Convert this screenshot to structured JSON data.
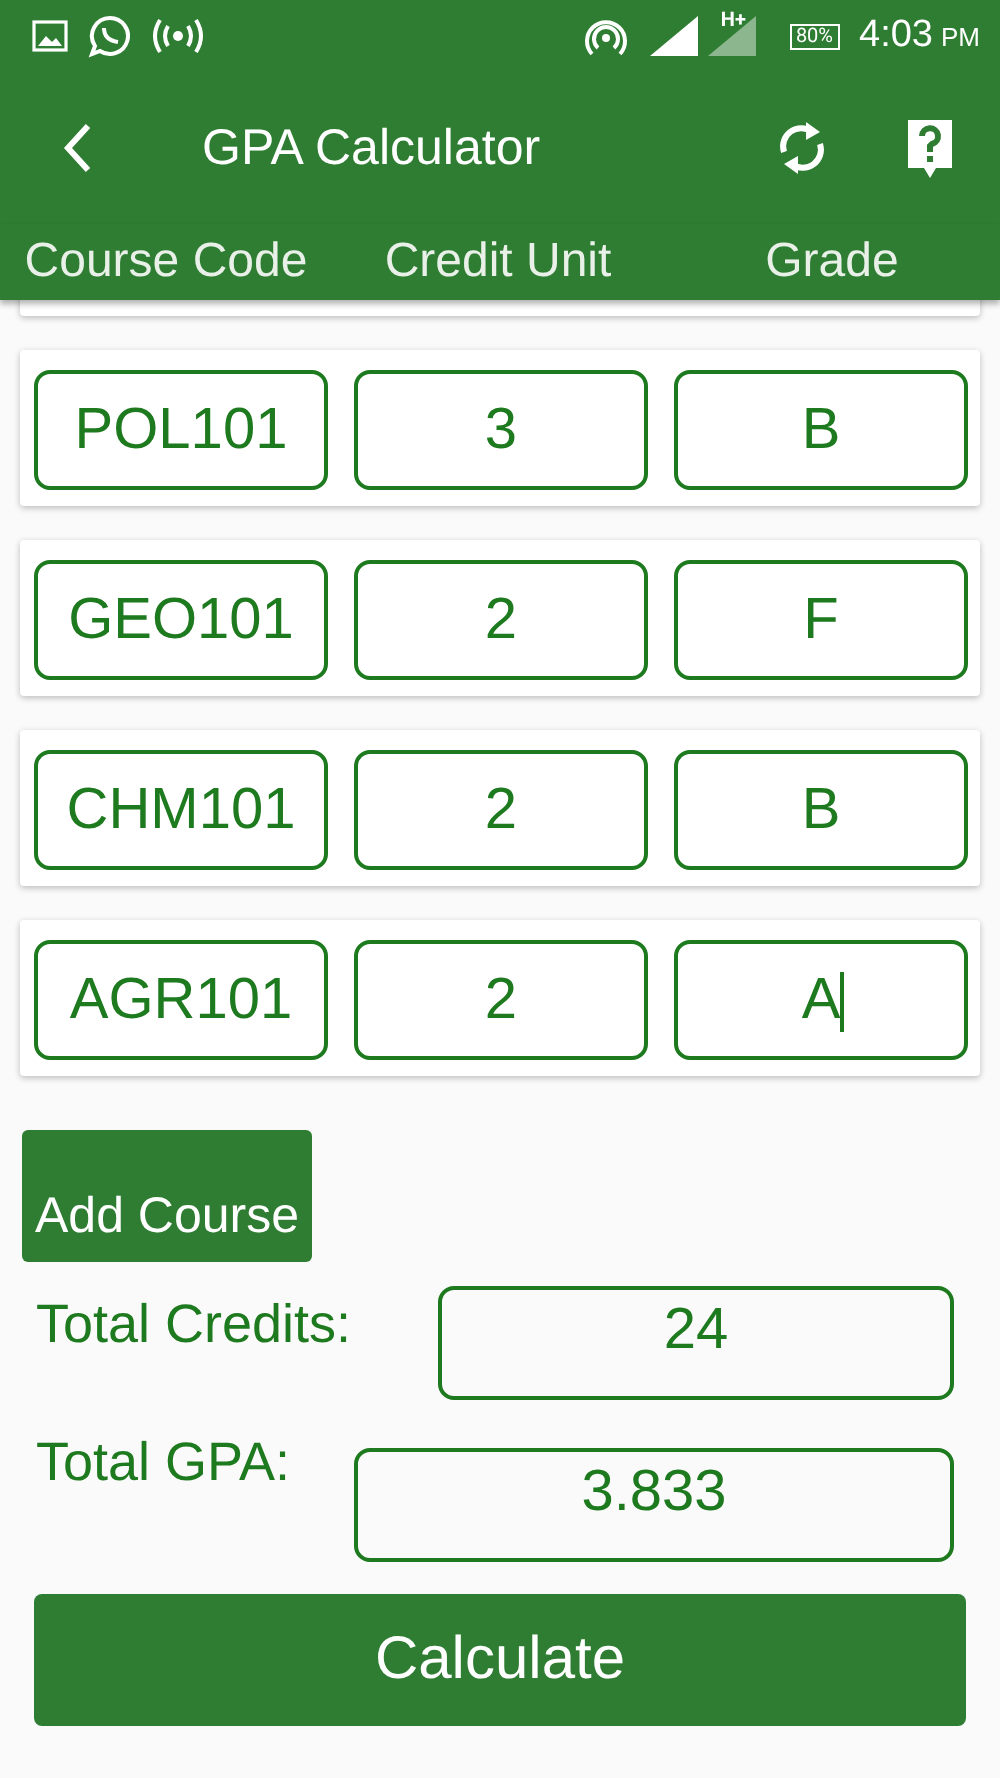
{
  "status_bar": {
    "network_type": "H+",
    "battery": "80%",
    "time": "4:03",
    "meridiem": "PM"
  },
  "toolbar": {
    "title": "GPA Calculator"
  },
  "columns": [
    "Course Code",
    "Credit Unit",
    "Grade"
  ],
  "courses": [
    {
      "code": "POL101",
      "credit": "3",
      "grade": "B",
      "focused": false
    },
    {
      "code": "GEO101",
      "credit": "2",
      "grade": "F",
      "focused": false
    },
    {
      "code": "CHM101",
      "credit": "2",
      "grade": "B",
      "focused": false
    },
    {
      "code": "AGR101",
      "credit": "2",
      "grade": "A",
      "focused": true
    }
  ],
  "add_button": "Add Course",
  "totals": [
    {
      "label": "Total Credits:",
      "value": "24"
    },
    {
      "label": "Total GPA:",
      "value": "3.833"
    }
  ],
  "calculate_button": "Calculate"
}
